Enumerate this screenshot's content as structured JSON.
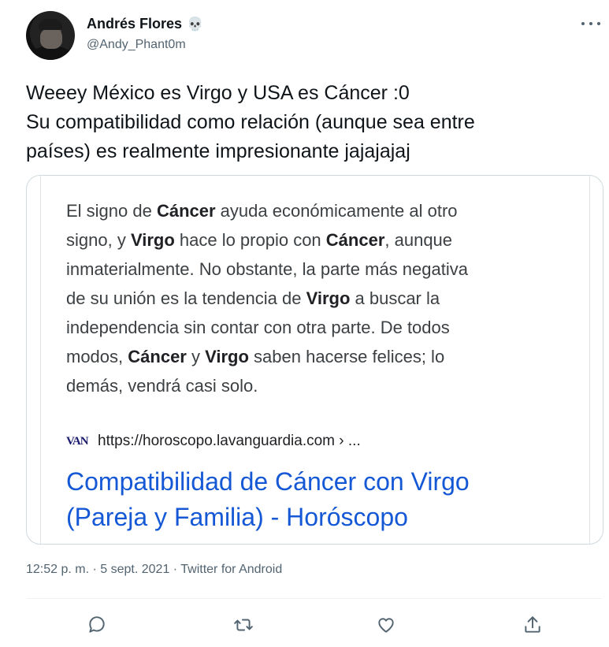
{
  "author": {
    "name": "Andrés Flores",
    "emoji": "💀",
    "handle": "@Andy_Phant0m"
  },
  "tweet": {
    "lines": [
      "Weeey México es Virgo y USA es Cáncer :0",
      "Su compatibilidad como relación (aunque sea entre",
      "países) es realmente impresionante jajajajaj"
    ]
  },
  "card": {
    "snippet_lines": [
      [
        {
          "t": "El signo de ",
          "b": false
        },
        {
          "t": "Cáncer",
          "b": true
        },
        {
          "t": " ayuda económicamente al otro",
          "b": false
        }
      ],
      [
        {
          "t": "signo, y ",
          "b": false
        },
        {
          "t": "Virgo",
          "b": true
        },
        {
          "t": " hace lo propio con ",
          "b": false
        },
        {
          "t": "Cáncer",
          "b": true
        },
        {
          "t": ", aunque",
          "b": false
        }
      ],
      [
        {
          "t": "inmaterialmente. No obstante, la parte más negativa",
          "b": false
        }
      ],
      [
        {
          "t": "de su unión es la tendencia de ",
          "b": false
        },
        {
          "t": "Virgo",
          "b": true
        },
        {
          "t": " a buscar la",
          "b": false
        }
      ],
      [
        {
          "t": "independencia sin contar con otra parte. De todos",
          "b": false
        }
      ],
      [
        {
          "t": "modos, ",
          "b": false
        },
        {
          "t": "Cáncer",
          "b": true
        },
        {
          "t": " y ",
          "b": false
        },
        {
          "t": "Virgo",
          "b": true
        },
        {
          "t": " saben hacerse felices; lo",
          "b": false
        }
      ],
      [
        {
          "t": "demás, vendrá casi solo.",
          "b": false
        }
      ]
    ],
    "favicon_text": "VAN",
    "source_url": "https://horoscopo.lavanguardia.com › ...",
    "title_lines": [
      "Compatibilidad de Cáncer con Virgo",
      "(Pareja y Familia) - Horóscopo"
    ]
  },
  "meta": "12:52 p. m. · 5 sept. 2021 · Twitter for Android",
  "icons": {
    "more": "more-options-icon",
    "reply": "reply-icon",
    "retweet": "retweet-icon",
    "like": "like-icon",
    "share": "share-icon"
  },
  "colors": {
    "text": "#0f1419",
    "secondary": "#536471",
    "link": "#1558d6",
    "border": "#cfd9de"
  }
}
